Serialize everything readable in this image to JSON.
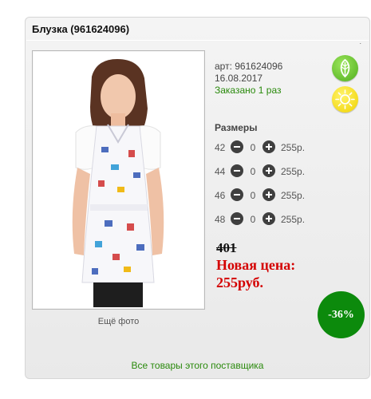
{
  "product": {
    "title": "Блузка (961624096)",
    "article": "арт: 961624096",
    "date": "16.08.2017",
    "ordered": "Заказано 1 раз",
    "more_photo": "Ещё фото"
  },
  "sizes": {
    "heading": "Размеры",
    "rows": [
      {
        "size": "42",
        "qty": "0",
        "price": "255р."
      },
      {
        "size": "44",
        "qty": "0",
        "price": "255р."
      },
      {
        "size": "46",
        "qty": "0",
        "price": "255р."
      },
      {
        "size": "48",
        "qty": "0",
        "price": "255р."
      }
    ]
  },
  "pricing": {
    "old_price": "401",
    "new_label": "Новая цена:",
    "new_price": "255руб.",
    "discount": "-36%"
  },
  "footer": {
    "supplier_link": "Все товары этого поставщика"
  },
  "icons": {
    "eco": "leaf-icon",
    "sun": "sun-icon"
  },
  "colors": {
    "accent_green": "#2a8a0c",
    "price_red": "#d40000",
    "discount_bg": "#0c8a0c"
  }
}
